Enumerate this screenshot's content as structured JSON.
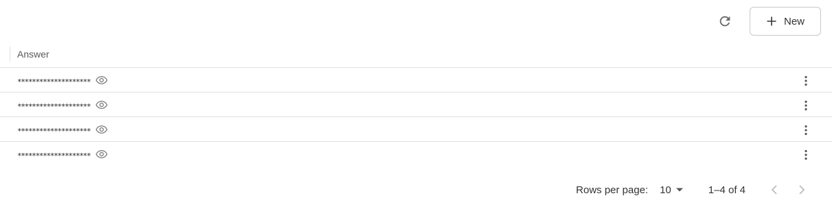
{
  "toolbar": {
    "refresh_icon": "refresh-icon",
    "new_label": "New",
    "new_icon": "plus-icon"
  },
  "table": {
    "columns": [
      {
        "label": "Answer"
      }
    ],
    "rows": [
      {
        "answer_masked": "********************"
      },
      {
        "answer_masked": "********************"
      },
      {
        "answer_masked": "********************"
      },
      {
        "answer_masked": "********************"
      }
    ]
  },
  "pagination": {
    "rows_per_page_label": "Rows per page:",
    "rows_per_page_value": "10",
    "range_text": "1–4 of 4",
    "prev_disabled": true,
    "next_disabled": true
  },
  "colors": {
    "border": "#e0e0e0",
    "text": "#333333",
    "muted_icon": "#9e9e9e"
  }
}
